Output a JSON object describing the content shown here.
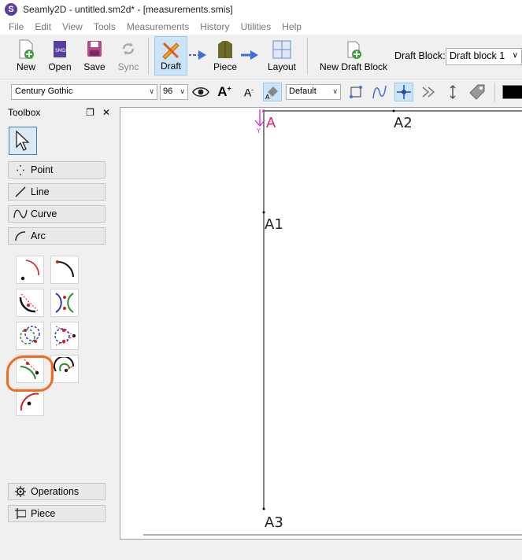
{
  "window": {
    "title": "Seamly2D - untitled.sm2d* - [measurements.smis]"
  },
  "menu": [
    "File",
    "Edit",
    "View",
    "Tools",
    "Measurements",
    "History",
    "Utilities",
    "Help"
  ],
  "toolbar": {
    "new": "New",
    "open": "Open",
    "save": "Save",
    "sync": "Sync",
    "draft": "Draft",
    "piece": "Piece",
    "layout": "Layout",
    "new_draft_block": "New Draft Block",
    "draft_block_label": "Draft Block:",
    "draft_block_value": "Draft block 1"
  },
  "format": {
    "font": "Century Gothic",
    "size": "96",
    "style": "Default"
  },
  "toolbox": {
    "title": "Toolbox",
    "categories": {
      "point": "Point",
      "line": "Line",
      "curve": "Curve",
      "arc": "Arc",
      "operations": "Operations",
      "piece": "Piece"
    }
  },
  "canvas": {
    "points": {
      "origin": "A",
      "a1": "A1",
      "a2": "A2",
      "a3": "A3"
    },
    "axis_y": "Y"
  },
  "colors": {
    "accent": "#cce4f7",
    "highlight": "#f26a1b",
    "origin": "#e0246a",
    "axis": "#d02bd0"
  }
}
